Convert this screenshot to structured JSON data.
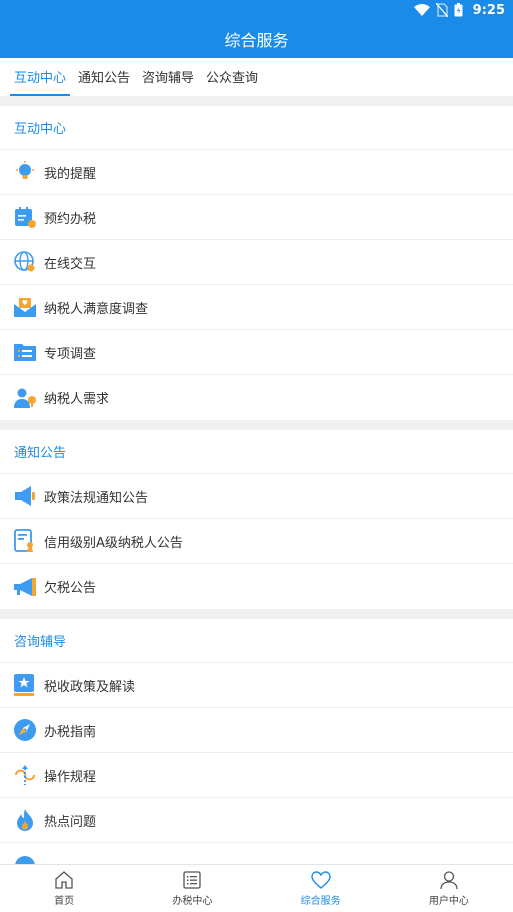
{
  "status": {
    "time": "9:25"
  },
  "header": {
    "title": "综合服务"
  },
  "tabs": [
    {
      "label": "互动中心"
    },
    {
      "label": "通知公告"
    },
    {
      "label": "咨询辅导"
    },
    {
      "label": "公众查询"
    }
  ],
  "sections": [
    {
      "title": "互动中心",
      "items": [
        {
          "label": "我的提醒",
          "icon": "lightbulb-icon"
        },
        {
          "label": "预约办税",
          "icon": "calendar-icon"
        },
        {
          "label": "在线交互",
          "icon": "globe-icon"
        },
        {
          "label": "纳税人满意度调查",
          "icon": "mail-heart-icon"
        },
        {
          "label": "专项调查",
          "icon": "folder-list-icon"
        },
        {
          "label": "纳税人需求",
          "icon": "user-idea-icon"
        }
      ]
    },
    {
      "title": "通知公告",
      "items": [
        {
          "label": "政策法规通知公告",
          "icon": "megaphone-icon"
        },
        {
          "label": "信用级别A级纳税人公告",
          "icon": "certificate-icon"
        },
        {
          "label": "欠税公告",
          "icon": "loudspeaker-icon"
        }
      ]
    },
    {
      "title": "咨询辅导",
      "items": [
        {
          "label": "税收政策及解读",
          "icon": "star-book-icon"
        },
        {
          "label": "办税指南",
          "icon": "compass-icon"
        },
        {
          "label": "操作规程",
          "icon": "flow-icon"
        },
        {
          "label": "热点问题",
          "icon": "flame-icon"
        }
      ]
    }
  ],
  "bottom_nav": [
    {
      "label": "首页",
      "icon": "home-icon"
    },
    {
      "label": "办税中心",
      "icon": "list-icon"
    },
    {
      "label": "综合服务",
      "icon": "heart-icon"
    },
    {
      "label": "用户中心",
      "icon": "user-icon"
    }
  ],
  "colors": {
    "primary": "#1a8be8",
    "accent_orange": "#f7a531"
  }
}
